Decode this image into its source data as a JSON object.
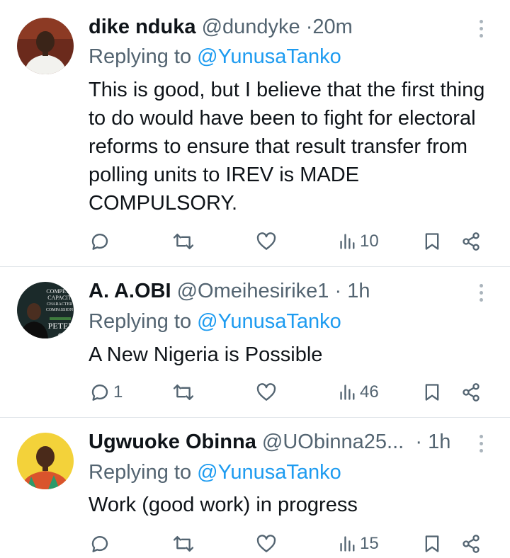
{
  "tweets": [
    {
      "name": "dike nduka",
      "handle": "@dundyke",
      "separator": "·",
      "time": "20m",
      "replying_prefix": "Replying to ",
      "replying_handle": "@YunusaTanko",
      "text": "This is good, but I believe that the first thing to do would have been to fight for electoral reforms to ensure that result transfer from polling units to IREV is MADE COMPULSORY.",
      "counts": {
        "replies": "",
        "retweets": "",
        "likes": "",
        "views": "10"
      }
    },
    {
      "name": "A. A.OBI",
      "handle": "@Omeihesirike1",
      "separator": "·",
      "time": "1h",
      "replying_prefix": "Replying to ",
      "replying_handle": "@YunusaTanko",
      "text": "A New Nigeria is Possible",
      "avatar_text": [
        "COMPETE",
        "CAPACIT",
        "CHARACTER",
        "COMPASSION",
        "PETER",
        "O"
      ],
      "counts": {
        "replies": "1",
        "retweets": "",
        "likes": "",
        "views": "46"
      }
    },
    {
      "name": "Ugwuoke Obinna",
      "handle": "@UObinna25...",
      "separator": "·",
      "time": "1h",
      "replying_prefix": "Replying to ",
      "replying_handle": "@YunusaTanko",
      "text": "Work (good work) in progress",
      "counts": {
        "replies": "",
        "retweets": "",
        "likes": "",
        "views": "15"
      }
    }
  ],
  "colors": {
    "text": "#0f1419",
    "secondary": "#536471",
    "accent": "#1d9bf0",
    "divider": "#e1e6ea"
  },
  "icons": [
    "reply-icon",
    "retweet-icon",
    "like-icon",
    "views-icon",
    "bookmark-icon",
    "share-icon",
    "more-icon"
  ]
}
